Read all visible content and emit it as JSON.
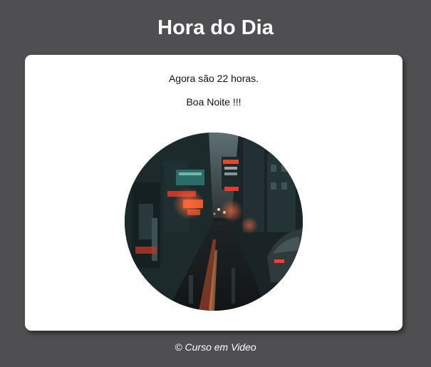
{
  "header": {
    "title": "Hora do Dia"
  },
  "card": {
    "hours_message": "Agora são 22 horas.",
    "greeting": "Boa Noite !!!",
    "photo_icon": "night-city-street-photo"
  },
  "footer": {
    "text": "© Curso em Video"
  },
  "colors": {
    "background": "#4f4f51",
    "card": "#ffffff",
    "title": "#ffffff",
    "neon_red": "#e8452e",
    "neon_teal": "#3fb8a8"
  }
}
